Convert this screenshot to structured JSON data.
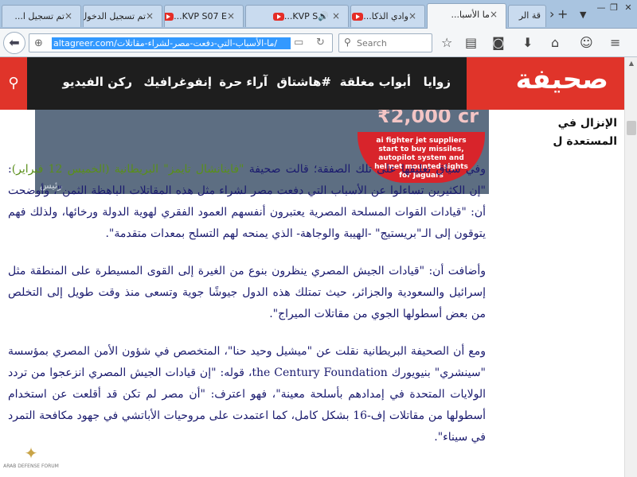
{
  "tabs": [
    {
      "label": "تم تسجيل ا...",
      "type": "page"
    },
    {
      "label": "تم تسجيل الدخول",
      "type": "page"
    },
    {
      "label": "KVP S07 E...",
      "type": "youtube"
    },
    {
      "label": "KVP S...",
      "type": "youtube"
    },
    {
      "label": "وادي الذكا...",
      "type": "youtube"
    },
    {
      "label": "ما الأسبا...",
      "type": "active"
    },
    {
      "label": "قة الر",
      "type": "page"
    }
  ],
  "address": {
    "url": "altagreer.com/ما-الأسباب-التي-دفعت-مصر-لشراء-مقاتلات/"
  },
  "search": {
    "placeholder": "Search"
  },
  "site": {
    "logo": "صحيفة",
    "nav": [
      "زوايا",
      "أبواب مغلقة",
      "#هاشتاق",
      "آراء حرة",
      "إنفوغرافيك",
      "ركن الفيديو"
    ]
  },
  "banner": {
    "money": "₹2,000 cr",
    "promo": "ai fighter jet suppliers\nstart to buy missiles,\nautopilot system and\nhelmet mounted sights\nfor Jaguars",
    "caption": "رئيس"
  },
  "teaser": {
    "line1": "الإنزال في",
    "line2": "المستعدة ل"
  },
  "article": {
    "p1_a": "وفي سياق تعليقها على تلك الصفقة؛ قالت صحيفة ",
    "p1_hl": "\"فاينانشال تايمز\" البريطانية (الخميس 12 فبراير)",
    "p1_b": ": \"إن الكثيرين تساءلوا عن الأسباب التي دفعت مصر لشراء مثل هذه المقاتلات الباهظة الثمن\"، وأوضحت أن: \"قيادات القوات المسلحة المصرية يعتبرون أنفسهم العمود الفقري لهوية الدولة ورخائها، ولذلك فهم يتوقون إلى الـ\"بريستيج\" -الهيبة والوجاهة- الذي يمنحه لهم التسلح بمعدات متقدمة\".",
    "p2": "وأضافت أن: \"قيادات الجيش المصري ينظرون بنوع من الغيرة إلى القوى المسيطرة على المنطقة مثل إسرائيل والسعودية والجزائر، حيث تمتلك هذه الدول جيوشًا جوية وتسعى منذ وقت طويل إلى التخلص من بعض أسطولها الجوي من مقاتلات الميراج\".",
    "p3": "ومع أن الصحيفة البريطانية نقلت عن \"ميشيل وحيد حنا\"، المتخصص في شؤون الأمن المصري بمؤسسة \"سينشري\" بنيويورك the Century Foundation، قوله: \"إن قيادات الجيش المصري انزعجوا من تردد الولايات المتحدة في إمدادهم بأسلحة معينة\"، فهو اعترف: \"أن مصر لم تكن قد أقلعت عن استخدام أسطولها من مقاتلات إف-16 بشكل كامل، كما اعتمدت على مروحيات الأباتشي في جهود مكافحة التمرد في سيناء\"."
  },
  "watermark": {
    "text": "ARAB DEFENSE FORUM"
  },
  "colors": {
    "brand_red": "#e0342a",
    "nav_black": "#1e1e1e",
    "text_blue": "#1a1a6e",
    "highlight_green": "#5a8f1a"
  }
}
